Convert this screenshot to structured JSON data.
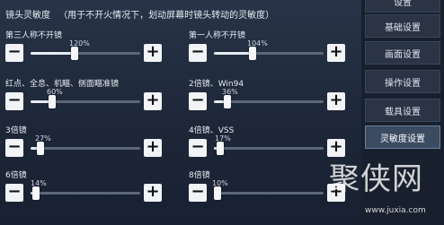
{
  "header": {
    "title": "镜头灵敏度",
    "subtitle": "（用于不开火情况下，划动屏幕时镜头转动的灵敏度）"
  },
  "sliders": [
    {
      "id": "third-person",
      "label": "第三人称不开镜",
      "value_text": "120%",
      "value": 0.4
    },
    {
      "id": "first-person",
      "label": "第一人称不开镜",
      "value_text": "104%",
      "value": 0.35
    },
    {
      "id": "red-dot",
      "label": "红点、全息、机瞄、侧面瞄准镜",
      "value_text": "60%",
      "value": 0.2
    },
    {
      "id": "2x",
      "label": "2倍镜、Win94",
      "value_text": "36%",
      "value": 0.12
    },
    {
      "id": "3x",
      "label": "3倍镜",
      "value_text": "27%",
      "value": 0.09
    },
    {
      "id": "4x",
      "label": "4倍镜、VSS",
      "value_text": "17%",
      "value": 0.06
    },
    {
      "id": "6x",
      "label": "6倍镜",
      "value_text": "14%",
      "value": 0.05
    },
    {
      "id": "8x",
      "label": "8倍镜",
      "value_text": "10%",
      "value": 0.03
    }
  ],
  "buttons": {
    "minus": "−",
    "plus": "+"
  },
  "sidebar": {
    "tabs": [
      {
        "label": "设置",
        "active": false
      },
      {
        "label": "基础设置",
        "active": false
      },
      {
        "label": "画面设置",
        "active": false
      },
      {
        "label": "操作设置",
        "active": false
      },
      {
        "label": "载具设置",
        "active": false
      },
      {
        "label": "灵敏度设置",
        "active": true
      }
    ]
  },
  "watermark": {
    "logo": "聚侠网",
    "url": "www.juxia.com"
  },
  "colors": {
    "accent": "#e7ecf2",
    "track": "#5c6778",
    "active_tab": "#3b4b61"
  }
}
